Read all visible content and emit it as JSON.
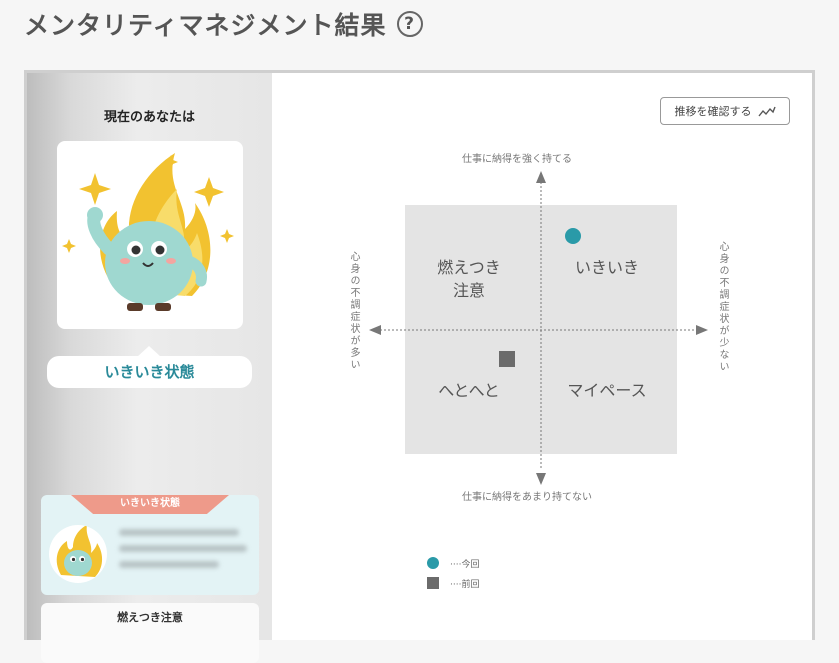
{
  "header": {
    "title": "メンタリティマネジメント結果",
    "help_glyph": "?"
  },
  "left_panel": {
    "current_label": "現在のあなたは",
    "state_label": "いきいき状態",
    "cards": [
      {
        "title": "いきいき状態",
        "header_color": "#ee9a8a",
        "background": "#e3f3f5"
      },
      {
        "title": "燃えつき注意"
      }
    ]
  },
  "chart": {
    "history_button_label": "推移を確認する",
    "history_icon": "trend-line-icon",
    "axis_top": "仕事に納得を強く持てる",
    "axis_bottom": "仕事に納得をあまり持てない",
    "axis_left": "心身の不調症状が多い",
    "axis_right": "心身の不調症状が少ない",
    "quadrants": {
      "top_left": "燃えつき\n注意",
      "top_right": "いきいき",
      "bottom_left": "へとへと",
      "bottom_right": "マイペース"
    },
    "markers": [
      {
        "name": "今回",
        "shape": "circle",
        "color": "#2a9aa8",
        "quadrant": "いきいき"
      },
      {
        "name": "前回",
        "shape": "square",
        "color": "#6b6b6b",
        "quadrant": "へとへと"
      }
    ],
    "legend": [
      {
        "shape": "circle",
        "color": "#2a9aa8",
        "label": "今回"
      },
      {
        "shape": "square",
        "color": "#6b6b6b",
        "label": "前回"
      }
    ]
  }
}
